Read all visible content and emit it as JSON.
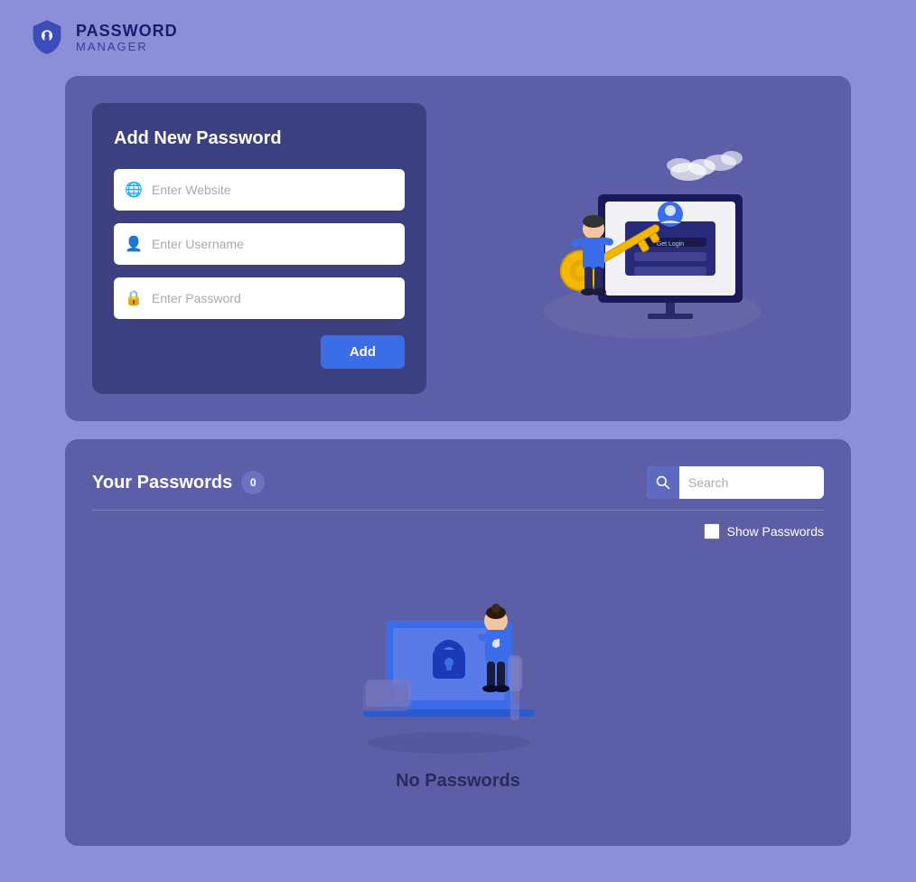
{
  "app": {
    "name_line1": "PASSWORD",
    "name_line2": "MANAGER"
  },
  "add_password": {
    "title": "Add New Password",
    "website_placeholder": "Enter Website",
    "username_placeholder": "Enter Username",
    "password_placeholder": "Enter Password",
    "add_button": "Add"
  },
  "your_passwords": {
    "title": "Your Passwords",
    "count": "0",
    "search_placeholder": "Search",
    "show_passwords_label": "Show Passwords",
    "empty_text": "No Passwords"
  }
}
